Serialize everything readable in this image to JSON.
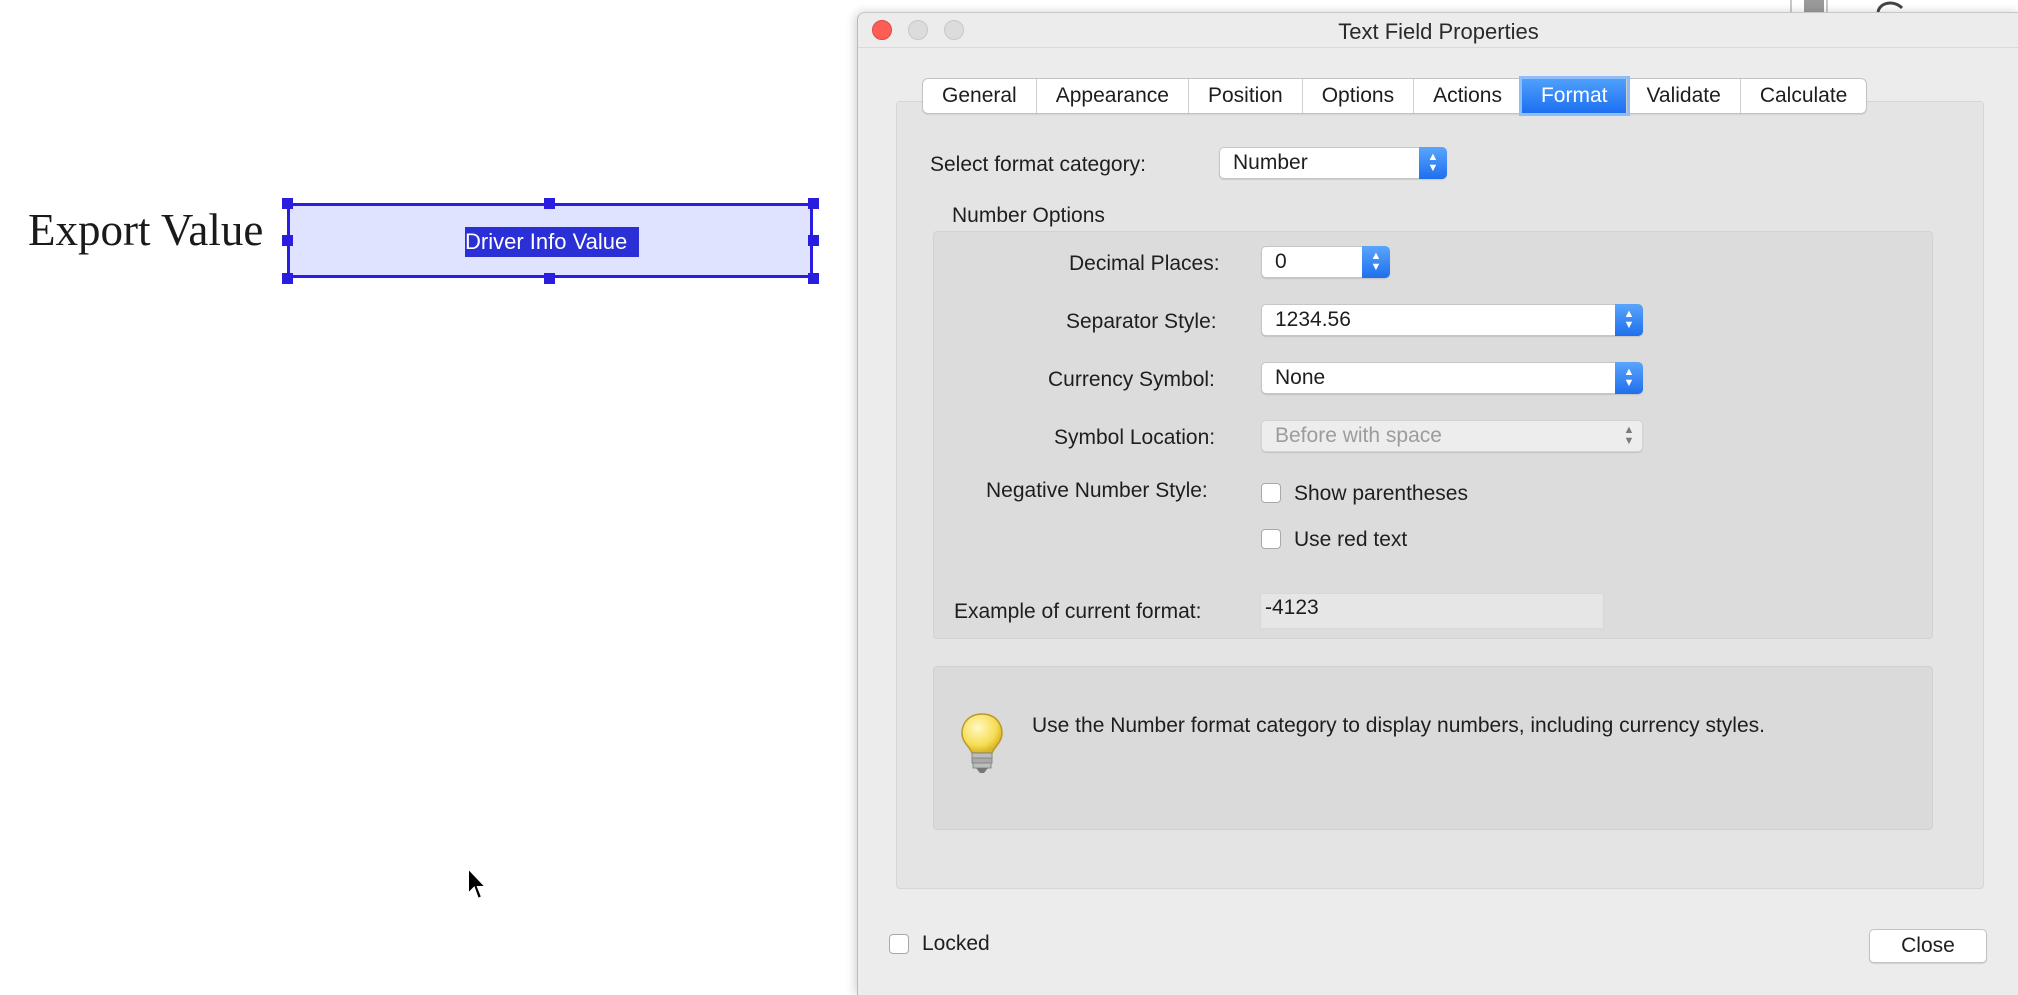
{
  "document": {
    "label": "Export Value",
    "field_text": "Driver Info Value"
  },
  "dialog": {
    "title": "Text Field Properties",
    "tabs": [
      {
        "label": "General",
        "active": false
      },
      {
        "label": "Appearance",
        "active": false
      },
      {
        "label": "Position",
        "active": false
      },
      {
        "label": "Options",
        "active": false
      },
      {
        "label": "Actions",
        "active": false
      },
      {
        "label": "Format",
        "active": true
      },
      {
        "label": "Validate",
        "active": false
      },
      {
        "label": "Calculate",
        "active": false
      }
    ],
    "format": {
      "category_label": "Select format category:",
      "category_value": "Number",
      "group_title": "Number Options",
      "decimal_places_label": "Decimal Places:",
      "decimal_places_value": "0",
      "separator_label": "Separator Style:",
      "separator_value": "1234.56",
      "currency_label": "Currency Symbol:",
      "currency_value": "None",
      "symbol_location_label": "Symbol Location:",
      "symbol_location_value": "Before with space",
      "negative_label": "Negative Number Style:",
      "show_parentheses_label": "Show parentheses",
      "show_parentheses_checked": false,
      "use_red_label": "Use red text",
      "use_red_checked": false,
      "example_label": "Example of current format:",
      "example_value": "-4123",
      "tip_text": "Use the Number format category to display numbers, including currency styles."
    },
    "locked_label": "Locked",
    "locked_checked": false,
    "close_label": "Close"
  },
  "colors": {
    "accent": "#1c6ff1",
    "selection": "#2a1de0",
    "traffic_close": "#fc5d55"
  },
  "icons": [
    "arrow-cursor-icon",
    "lightbulb-icon",
    "updown-stepper-icon"
  ]
}
